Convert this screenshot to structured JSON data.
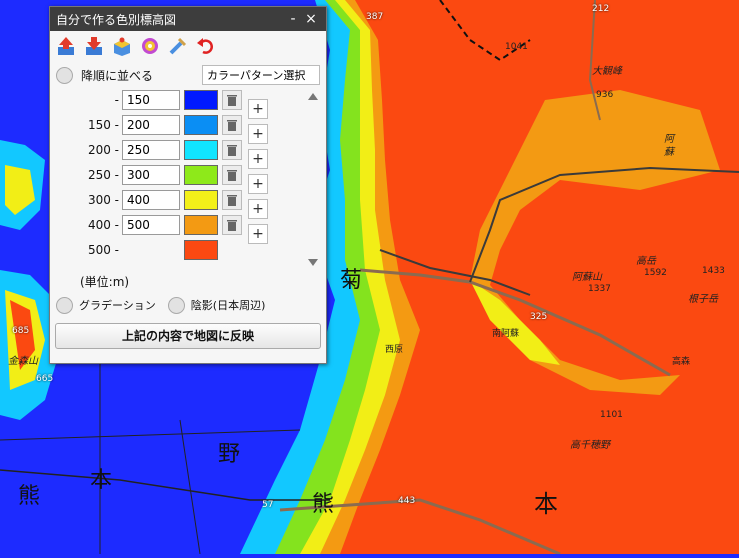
{
  "map": {
    "labels": {
      "r387": "387",
      "r212": "212",
      "e1041": "1041",
      "oogan": "大観峰",
      "e936": "936",
      "aso": "阿",
      "aso2": "蘇",
      "takadake": "高岳",
      "asosan": "阿蘇山",
      "e1592": "1592",
      "e1337": "1337",
      "e1433": "1433",
      "nekodake": "根子岳",
      "r325": "325",
      "minamiaso": "南阿蘇",
      "takamori": "高森",
      "nishihara": "西原",
      "e1101": "1101",
      "takachiho": "高千穂野",
      "e685": "685",
      "e665": "665",
      "kashima": "金森山",
      "kumamoto1": "熊",
      "kumamoto2": "本",
      "kuma3": "熊",
      "hon": "本",
      "no": "野",
      "r443": "443",
      "r57": "57",
      "kiku": "菊"
    }
  },
  "panel": {
    "title": "自分で作る色別標高図",
    "minimize": "-",
    "close": "×",
    "tools": [
      "upload-icon",
      "download-icon",
      "box-icon",
      "gear-icon",
      "tool-icon",
      "undo-icon"
    ],
    "sort_label": "降順に並べる",
    "pattern_select": "カラーパターン選択",
    "rows": [
      {
        "from": "-",
        "to": "150",
        "color": "#0019ff"
      },
      {
        "from": "150 -",
        "to": "200",
        "color": "#0a8ef4"
      },
      {
        "from": "200 -",
        "to": "250",
        "color": "#11e4ff"
      },
      {
        "from": "250 -",
        "to": "300",
        "color": "#8ee91a"
      },
      {
        "from": "300 -",
        "to": "400",
        "color": "#f3f019"
      },
      {
        "from": "400 -",
        "to": "500",
        "color": "#f39a13"
      },
      {
        "from": "500 -",
        "to": "",
        "color": "#fb4912"
      }
    ],
    "plus": "+",
    "unit": "(単位:m)",
    "gradation": "グラデーション",
    "shade": "陰影(日本周辺)",
    "apply": "上記の内容で地図に反映"
  }
}
